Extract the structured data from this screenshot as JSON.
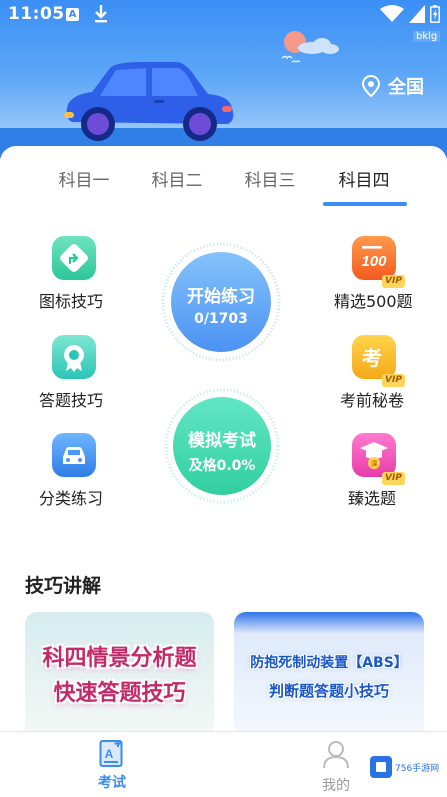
{
  "status_bar": {
    "time": "11:05",
    "a_label": "A",
    "badge": "bklg"
  },
  "header": {
    "location": "全国"
  },
  "tabs": [
    {
      "label": "科目一",
      "active": false
    },
    {
      "label": "科目二",
      "active": false
    },
    {
      "label": "科目三",
      "active": false
    },
    {
      "label": "科目四",
      "active": true
    }
  ],
  "left_items": [
    {
      "label": "图标技巧",
      "icon": "direction-sign-icon"
    },
    {
      "label": "答题技巧",
      "icon": "badge-icon"
    },
    {
      "label": "分类练习",
      "icon": "car-icon"
    }
  ],
  "right_items": [
    {
      "label": "精选500题",
      "icon": "score-100-icon",
      "icon_text": "100",
      "vip": "VIP"
    },
    {
      "label": "考前秘卷",
      "icon": "exam-icon",
      "icon_text": "考",
      "vip": "VIP"
    },
    {
      "label": "臻选题",
      "icon": "graduation-cap-icon",
      "icon_text": "课",
      "vip": "VIP"
    }
  ],
  "practice": {
    "title": "开始练习",
    "progress": "0/1703"
  },
  "mock_exam": {
    "title": "模拟考试",
    "pass_rate": "及格0.0%"
  },
  "skills": {
    "title": "技巧讲解",
    "banners": [
      {
        "line1": "科四情景分析题",
        "line2": "快速答题技巧"
      },
      {
        "line1": "防抱死制动装置【ABS】",
        "line2": "判断题答题小技巧"
      }
    ]
  },
  "bottom_nav": [
    {
      "label": "考试",
      "active": true,
      "color": "#3b8ef0"
    },
    {
      "label": "我的",
      "active": false,
      "color": "#888888"
    }
  ],
  "watermark": "756手游网",
  "colors": {
    "primary": "#3b8ef0",
    "practice": "#5fa5f6",
    "mock": "#48dcb5"
  }
}
